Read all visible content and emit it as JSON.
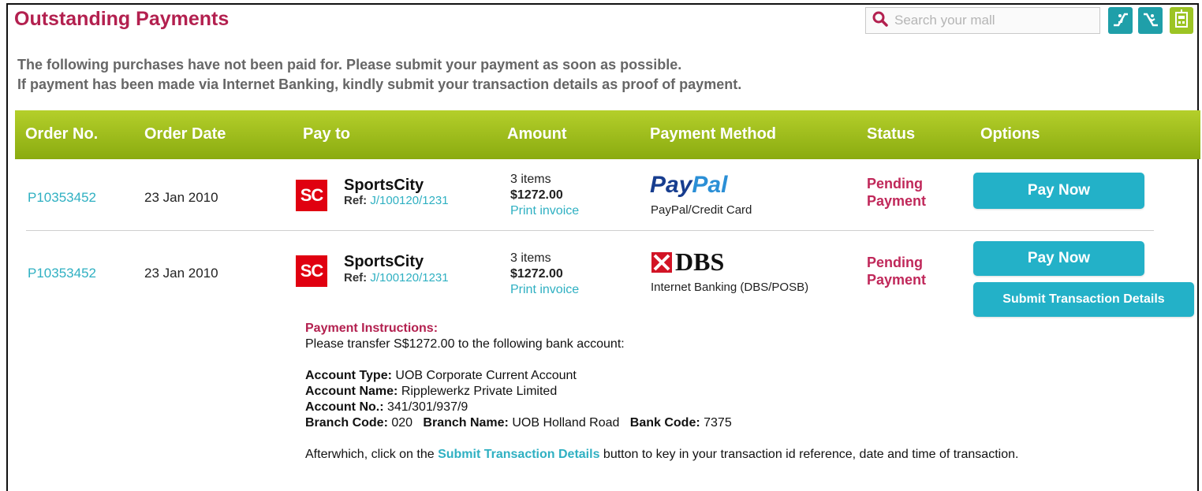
{
  "header": {
    "title": "Outstanding Payments",
    "search_placeholder": "Search your mall"
  },
  "intro": {
    "line1": "The following purchases have not been paid for. Please submit your payment as soon as possible.",
    "line2": "If  payment has been made via Internet Banking, kindly submit your transaction details as proof of payment."
  },
  "table": {
    "columns": [
      "Order No.",
      "Order Date",
      "Pay to",
      "Amount",
      "Payment Method",
      "Status",
      "Options"
    ],
    "rows": [
      {
        "order_no": "P10353452",
        "order_date": "23 Jan 2010",
        "logo_text": "SC",
        "shop": "SportsCity",
        "ref_label": "Ref:",
        "ref": "J/100120/1231",
        "items": "3 items",
        "amount": "$1272.00",
        "print": "Print invoice",
        "method_logo": "PayPal",
        "method": "PayPal/Credit Card",
        "status1": "Pending",
        "status2": "Payment",
        "pay_label": "Pay Now"
      },
      {
        "order_no": "P10353452",
        "order_date": "23 Jan 2010",
        "logo_text": "SC",
        "shop": "SportsCity",
        "ref_label": "Ref:",
        "ref": "J/100120/1231",
        "items": "3 items",
        "amount": "$1272.00",
        "print": "Print invoice",
        "method_logo": "DBS",
        "method": "Internet Banking (DBS/POSB)",
        "status1": "Pending",
        "status2": "Payment",
        "pay_label": "Pay Now",
        "submit_label": "Submit Transaction Details"
      }
    ]
  },
  "instructions": {
    "heading": "Payment Instructions:",
    "transfer": "Please transfer S$1272.00 to the following bank account:",
    "account_type_label": "Account Type:",
    "account_type": "UOB Corporate Current Account",
    "account_name_label": "Account Name:",
    "account_name": "Ripplewerkz Private Limited",
    "account_no_label": "Account No.:",
    "account_no": "341/301/937/9",
    "branch_code_label": "Branch Code:",
    "branch_code": "020",
    "branch_name_label": "Branch Name:",
    "branch_name": "UOB Holland Road",
    "bank_code_label": "Bank Code:",
    "bank_code": "7375",
    "after_1": "Afterwhich, click on the",
    "after_link": "Submit Transaction Details",
    "after_2": "button to key in your transaction id reference, date and time of transaction."
  },
  "colors": {
    "title": "#b3204f",
    "header_green": "#9cc424",
    "button_teal": "#23b1c8",
    "link": "#2fb0c2",
    "status": "#c0285a"
  },
  "icons": [
    "search-icon",
    "escalator-up-icon",
    "escalator-down-icon",
    "store-icon"
  ]
}
